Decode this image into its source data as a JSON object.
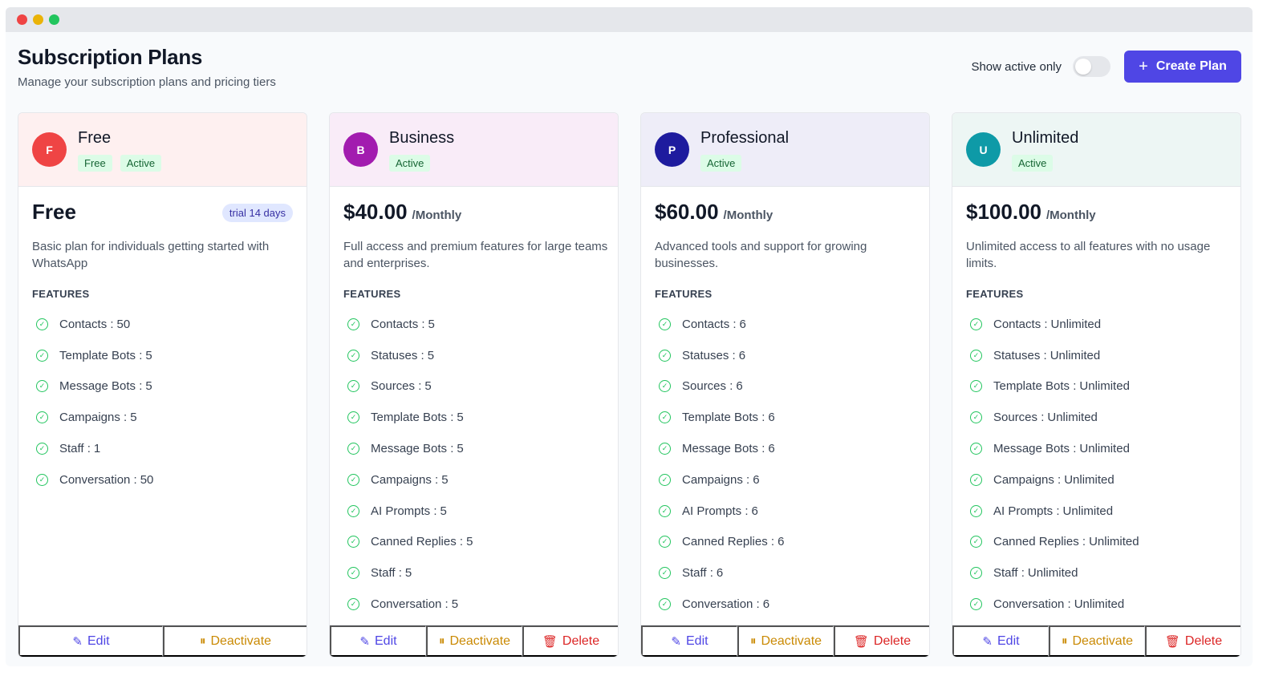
{
  "header": {
    "title": "Subscription Plans",
    "subtitle": "Manage your subscription plans and pricing tiers",
    "toggle_label": "Show active only",
    "create_label": "Create Plan"
  },
  "actions": {
    "edit": "Edit",
    "deactivate": "Deactivate",
    "delete": "Delete"
  },
  "features_title": "FEATURES",
  "colors": {
    "accent": "#4f46e5",
    "active_badge_bg": "#dcfce7",
    "active_badge_text": "#166534"
  },
  "plans": [
    {
      "initial": "F",
      "name": "Free",
      "badges": [
        "Free",
        "Active"
      ],
      "price": "Free",
      "period": "",
      "trial": "trial 14 days",
      "description": "Basic plan for individuals getting started with WhatsApp",
      "features": [
        {
          "label": "Contacts :",
          "value": "50"
        },
        {
          "label": "Template Bots :",
          "value": "5"
        },
        {
          "label": "Message Bots :",
          "value": "5"
        },
        {
          "label": "Campaigns :",
          "value": "5"
        },
        {
          "label": "Staff :",
          "value": "1"
        },
        {
          "label": "Conversation :",
          "value": "50"
        }
      ]
    },
    {
      "initial": "B",
      "name": "Business",
      "badges": [
        "Active"
      ],
      "price": "$40.00",
      "period": "/Monthly",
      "trial": "",
      "description": "Full access and premium features for large teams and enterprises.",
      "features": [
        {
          "label": "Contacts :",
          "value": "5"
        },
        {
          "label": "Statuses :",
          "value": "5"
        },
        {
          "label": "Sources :",
          "value": "5"
        },
        {
          "label": "Template Bots :",
          "value": "5"
        },
        {
          "label": "Message Bots :",
          "value": "5"
        },
        {
          "label": "Campaigns :",
          "value": "5"
        },
        {
          "label": "AI Prompts :",
          "value": "5"
        },
        {
          "label": "Canned Replies :",
          "value": "5"
        },
        {
          "label": "Staff :",
          "value": "5"
        },
        {
          "label": "Conversation :",
          "value": "5"
        }
      ]
    },
    {
      "initial": "P",
      "name": "Professional",
      "badges": [
        "Active"
      ],
      "price": "$60.00",
      "period": "/Monthly",
      "trial": "",
      "description": "Advanced tools and support for growing businesses.",
      "features": [
        {
          "label": "Contacts :",
          "value": "6"
        },
        {
          "label": "Statuses :",
          "value": "6"
        },
        {
          "label": "Sources :",
          "value": "6"
        },
        {
          "label": "Template Bots :",
          "value": "6"
        },
        {
          "label": "Message Bots :",
          "value": "6"
        },
        {
          "label": "Campaigns :",
          "value": "6"
        },
        {
          "label": "AI Prompts :",
          "value": "6"
        },
        {
          "label": "Canned Replies :",
          "value": "6"
        },
        {
          "label": "Staff :",
          "value": "6"
        },
        {
          "label": "Conversation :",
          "value": "6"
        }
      ]
    },
    {
      "initial": "U",
      "name": "Unlimited",
      "badges": [
        "Active"
      ],
      "price": "$100.00",
      "period": "/Monthly",
      "trial": "",
      "description": "Unlimited access to all features with no usage limits.",
      "features": [
        {
          "label": "Contacts :",
          "value": "Unlimited"
        },
        {
          "label": "Statuses :",
          "value": "Unlimited"
        },
        {
          "label": "Template Bots :",
          "value": "Unlimited"
        },
        {
          "label": "Sources :",
          "value": "Unlimited"
        },
        {
          "label": "Message Bots :",
          "value": "Unlimited"
        },
        {
          "label": "Campaigns :",
          "value": "Unlimited"
        },
        {
          "label": "AI Prompts :",
          "value": "Unlimited"
        },
        {
          "label": "Canned Replies :",
          "value": "Unlimited"
        },
        {
          "label": "Staff :",
          "value": "Unlimited"
        },
        {
          "label": "Conversation :",
          "value": "Unlimited"
        }
      ]
    }
  ]
}
